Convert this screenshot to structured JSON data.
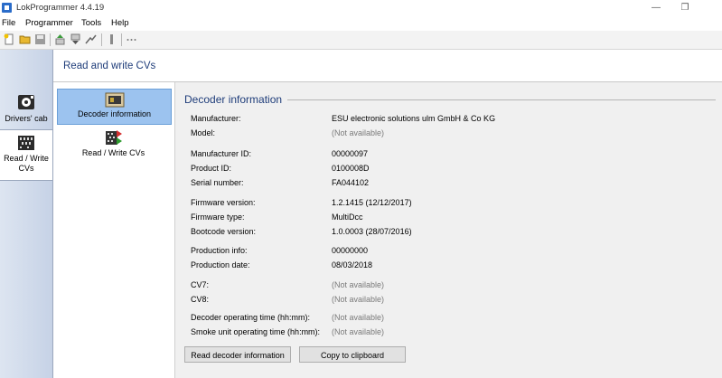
{
  "window": {
    "title": "LokProgrammer 4.4.19",
    "minimize": "—",
    "restore": "❐"
  },
  "menu": {
    "items": [
      "File",
      "Programmer",
      "Tools",
      "Help"
    ]
  },
  "sidebar": {
    "items": [
      {
        "label": "Drivers' cab"
      },
      {
        "label": "Read / Write CVs"
      }
    ]
  },
  "header": {
    "title": "Read and write CVs"
  },
  "nav": {
    "items": [
      {
        "label": "Decoder information"
      },
      {
        "label": "Read / Write CVs"
      }
    ]
  },
  "decoder": {
    "title": "Decoder information",
    "rows": [
      {
        "label": "Manufacturer:",
        "value": "ESU electronic solutions ulm GmbH & Co KG"
      },
      {
        "label": "Model:",
        "value": "(Not available)"
      },
      {
        "label": "Manufacturer ID:",
        "value": "00000097"
      },
      {
        "label": "Product ID:",
        "value": "0100008D"
      },
      {
        "label": "Serial number:",
        "value": "FA044102"
      },
      {
        "label": "Firmware version:",
        "value": "1.2.1415 (12/12/2017)"
      },
      {
        "label": "Firmware type:",
        "value": "MultiDcc"
      },
      {
        "label": "Bootcode version:",
        "value": "1.0.0003 (28/07/2016)"
      },
      {
        "label": "Production info:",
        "value": "00000000"
      },
      {
        "label": "Production date:",
        "value": "08/03/2018"
      },
      {
        "label": "CV7:",
        "value": "(Not available)"
      },
      {
        "label": "CV8:",
        "value": "(Not available)"
      },
      {
        "label": "Decoder operating time (hh:mm):",
        "value": "(Not available)"
      },
      {
        "label": "Smoke unit operating time (hh:mm):",
        "value": "(Not available)"
      }
    ]
  },
  "buttons": {
    "read": "Read decoder information",
    "copy": "Copy to clipboard"
  }
}
